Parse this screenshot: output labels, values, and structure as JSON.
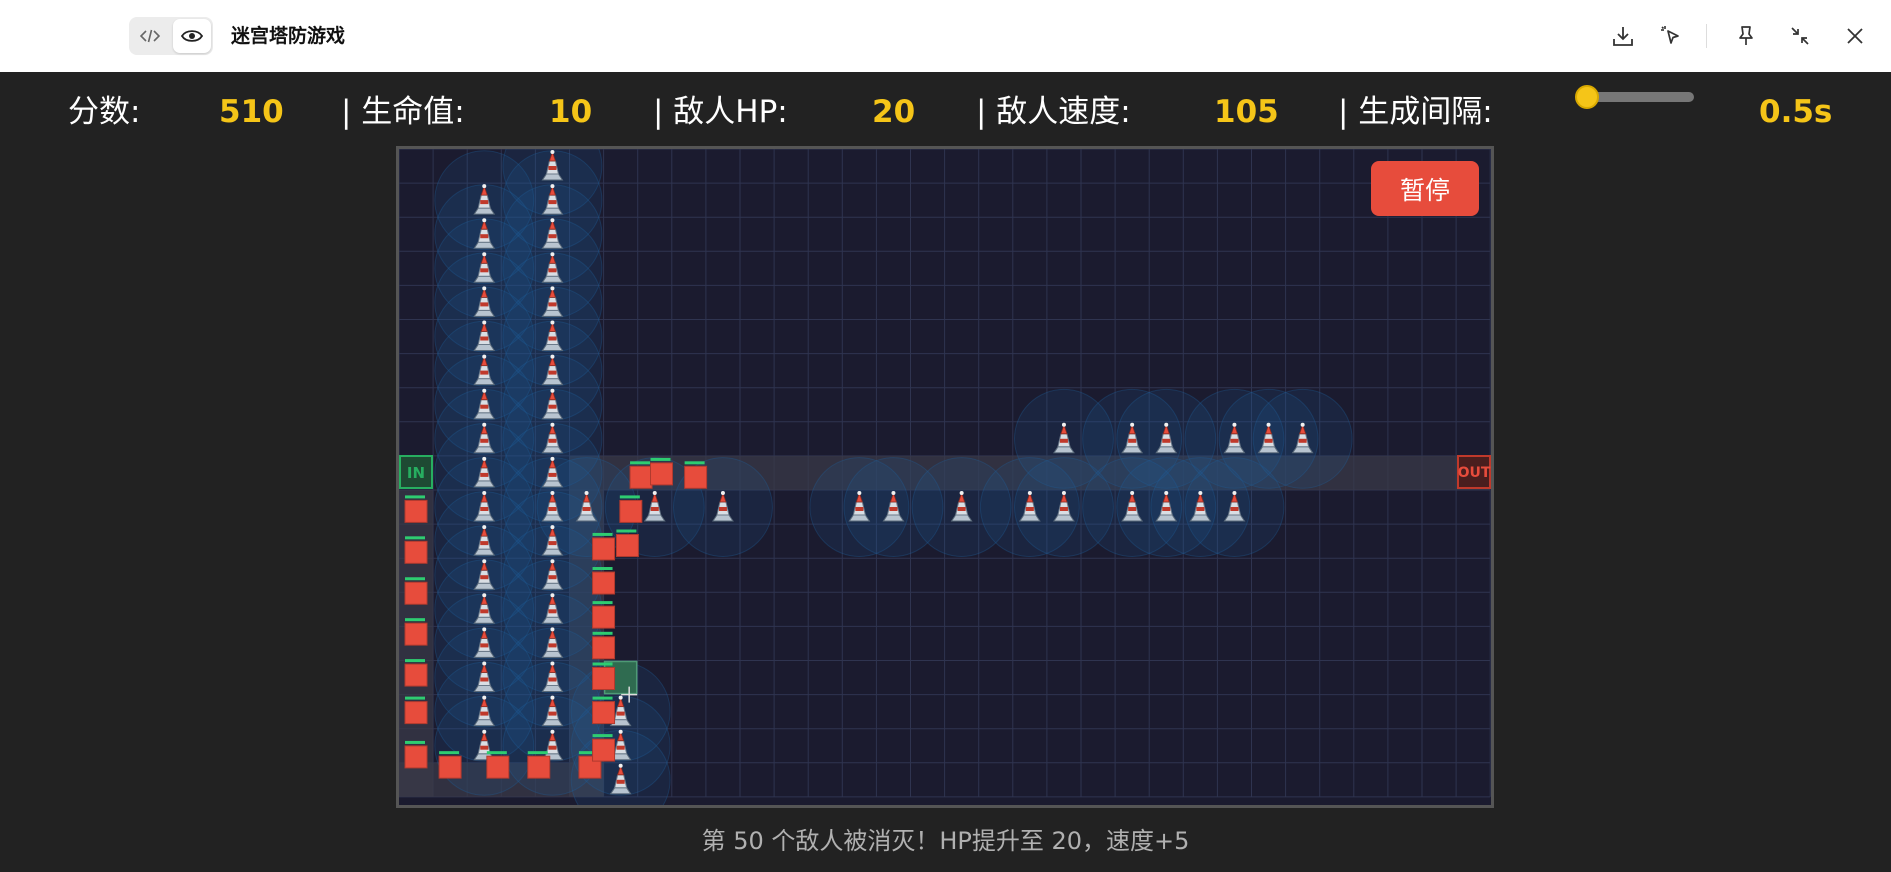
{
  "window": {
    "title": "迷宫塔防游戏",
    "toggle": {
      "code_icon": "code-icon",
      "preview_icon": "eye-icon",
      "active": "preview"
    },
    "actions": [
      "download-icon",
      "pointer-select-icon",
      "pin-icon",
      "minimize-icon",
      "close-icon"
    ]
  },
  "hud": {
    "score_label": "分数:",
    "score_value": "510",
    "lives_label": "| 生命值:",
    "lives_value": "10",
    "enemy_hp_label": "| 敌人HP:",
    "enemy_hp_value": "20",
    "enemy_speed_label": "| 敌人速度:",
    "enemy_speed_value": "105",
    "spawn_label": "| 生成间隔:",
    "spawn_value": "0.5s",
    "spawn_slider_level": 0.0
  },
  "board": {
    "cols": 32,
    "rows": 19,
    "entrance_label": "IN",
    "exit_label": "OUT",
    "pause_label": "暂停",
    "colors": {
      "background": "#1b1b2f",
      "grid": "#2f3450",
      "path": "#3a3a48",
      "enemy": "#e74c3c",
      "enemy_hp": "#2ecc71",
      "tower_range": "#1f5f99",
      "hover_cell": "#2f6b50",
      "entrance": "#27ae60",
      "exit": "#c0392b"
    },
    "towers": [
      [
        4,
        0
      ],
      [
        4,
        1
      ],
      [
        4,
        2
      ],
      [
        4,
        3
      ],
      [
        4,
        4
      ],
      [
        4,
        5
      ],
      [
        4,
        6
      ],
      [
        4,
        7
      ],
      [
        4,
        8
      ],
      [
        4,
        9
      ],
      [
        4,
        10
      ],
      [
        4,
        11
      ],
      [
        4,
        12
      ],
      [
        4,
        13
      ],
      [
        4,
        14
      ],
      [
        4,
        15
      ],
      [
        4,
        16
      ],
      [
        4,
        17
      ],
      [
        2,
        1
      ],
      [
        2,
        2
      ],
      [
        2,
        3
      ],
      [
        2,
        4
      ],
      [
        2,
        5
      ],
      [
        2,
        6
      ],
      [
        2,
        7
      ],
      [
        2,
        8
      ],
      [
        2,
        9
      ],
      [
        2,
        10
      ],
      [
        2,
        11
      ],
      [
        2,
        12
      ],
      [
        2,
        13
      ],
      [
        2,
        14
      ],
      [
        2,
        15
      ],
      [
        2,
        16
      ],
      [
        2,
        17
      ],
      [
        5,
        10
      ],
      [
        7,
        10
      ],
      [
        9,
        10
      ],
      [
        13,
        10
      ],
      [
        14,
        10
      ],
      [
        16,
        10
      ],
      [
        18,
        10
      ],
      [
        19,
        10
      ],
      [
        21,
        10
      ],
      [
        22,
        10
      ],
      [
        23,
        10
      ],
      [
        24,
        10
      ],
      [
        19,
        8
      ],
      [
        21,
        8
      ],
      [
        22,
        8
      ],
      [
        24,
        8
      ],
      [
        25,
        8
      ],
      [
        26,
        8
      ],
      [
        6,
        16
      ],
      [
        6,
        17
      ],
      [
        6,
        18
      ]
    ],
    "enemies": [
      [
        0,
        10.1
      ],
      [
        0,
        11.3
      ],
      [
        0,
        12.5
      ],
      [
        0,
        13.7
      ],
      [
        0,
        14.9
      ],
      [
        0,
        16.0
      ],
      [
        0,
        17.3
      ],
      [
        1,
        17.6
      ],
      [
        2.4,
        17.6
      ],
      [
        3.6,
        17.6
      ],
      [
        5.1,
        17.6
      ],
      [
        5.5,
        11.2
      ],
      [
        5.5,
        12.2
      ],
      [
        5.5,
        13.2
      ],
      [
        5.5,
        14.1
      ],
      [
        5.5,
        15.0
      ],
      [
        5.5,
        16.0
      ],
      [
        5.5,
        17.1
      ],
      [
        6.3,
        10.1
      ],
      [
        6.2,
        11.1
      ],
      [
        6.6,
        9.1
      ],
      [
        7.2,
        9.0
      ],
      [
        8.2,
        9.1
      ]
    ],
    "hover_cell": [
      6,
      15
    ]
  },
  "message": "第 50 个敌人被消灭！HP提升至 20，速度+5"
}
